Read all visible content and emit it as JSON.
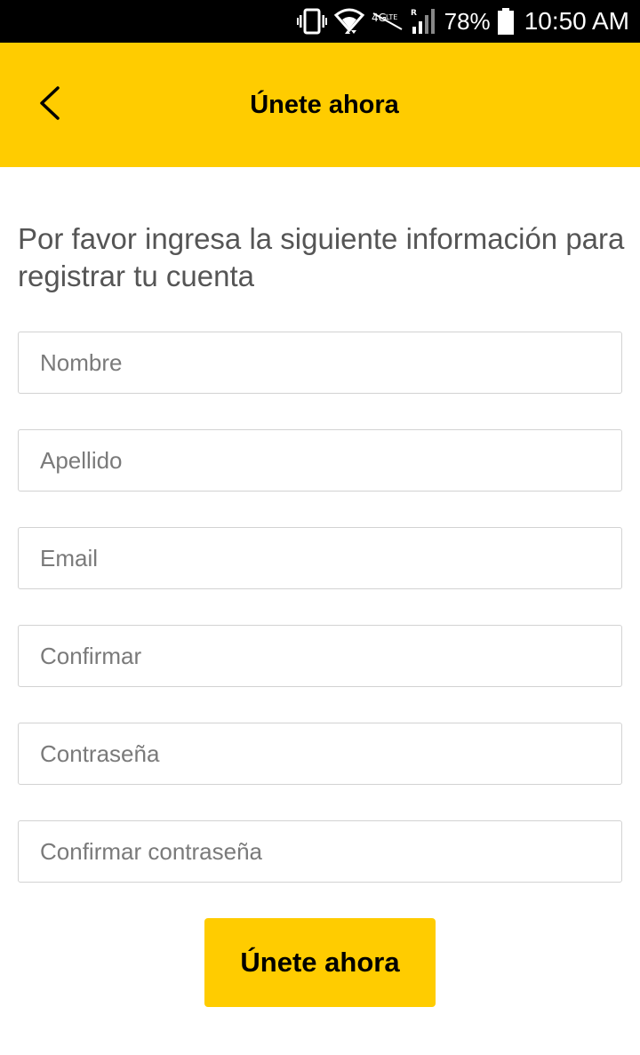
{
  "status_bar": {
    "battery_percent": "78%",
    "time": "10:50 AM",
    "icons": [
      "vibrate-icon",
      "wifi-icon",
      "data-transfer-icon",
      "lte-icon",
      "signal-icon",
      "battery-icon"
    ]
  },
  "header": {
    "back_icon": "chevron-left-icon",
    "title": "Únete ahora"
  },
  "form": {
    "intro_text": "Por favor ingresa la siguiente información para registrar tu cuenta",
    "fields": [
      {
        "placeholder": "Nombre",
        "value": ""
      },
      {
        "placeholder": "Apellido",
        "value": ""
      },
      {
        "placeholder": "Email",
        "value": ""
      },
      {
        "placeholder": "Confirmar",
        "value": ""
      },
      {
        "placeholder": "Contraseña",
        "value": ""
      },
      {
        "placeholder": "Confirmar contraseña",
        "value": ""
      }
    ],
    "submit_label": "Únete ahora"
  },
  "colors": {
    "brand_yellow": "#ffcc00",
    "status_bar": "#000000",
    "intro_text": "#555555",
    "field_border": "#d2d2d2",
    "placeholder": "#7a7a7a"
  }
}
